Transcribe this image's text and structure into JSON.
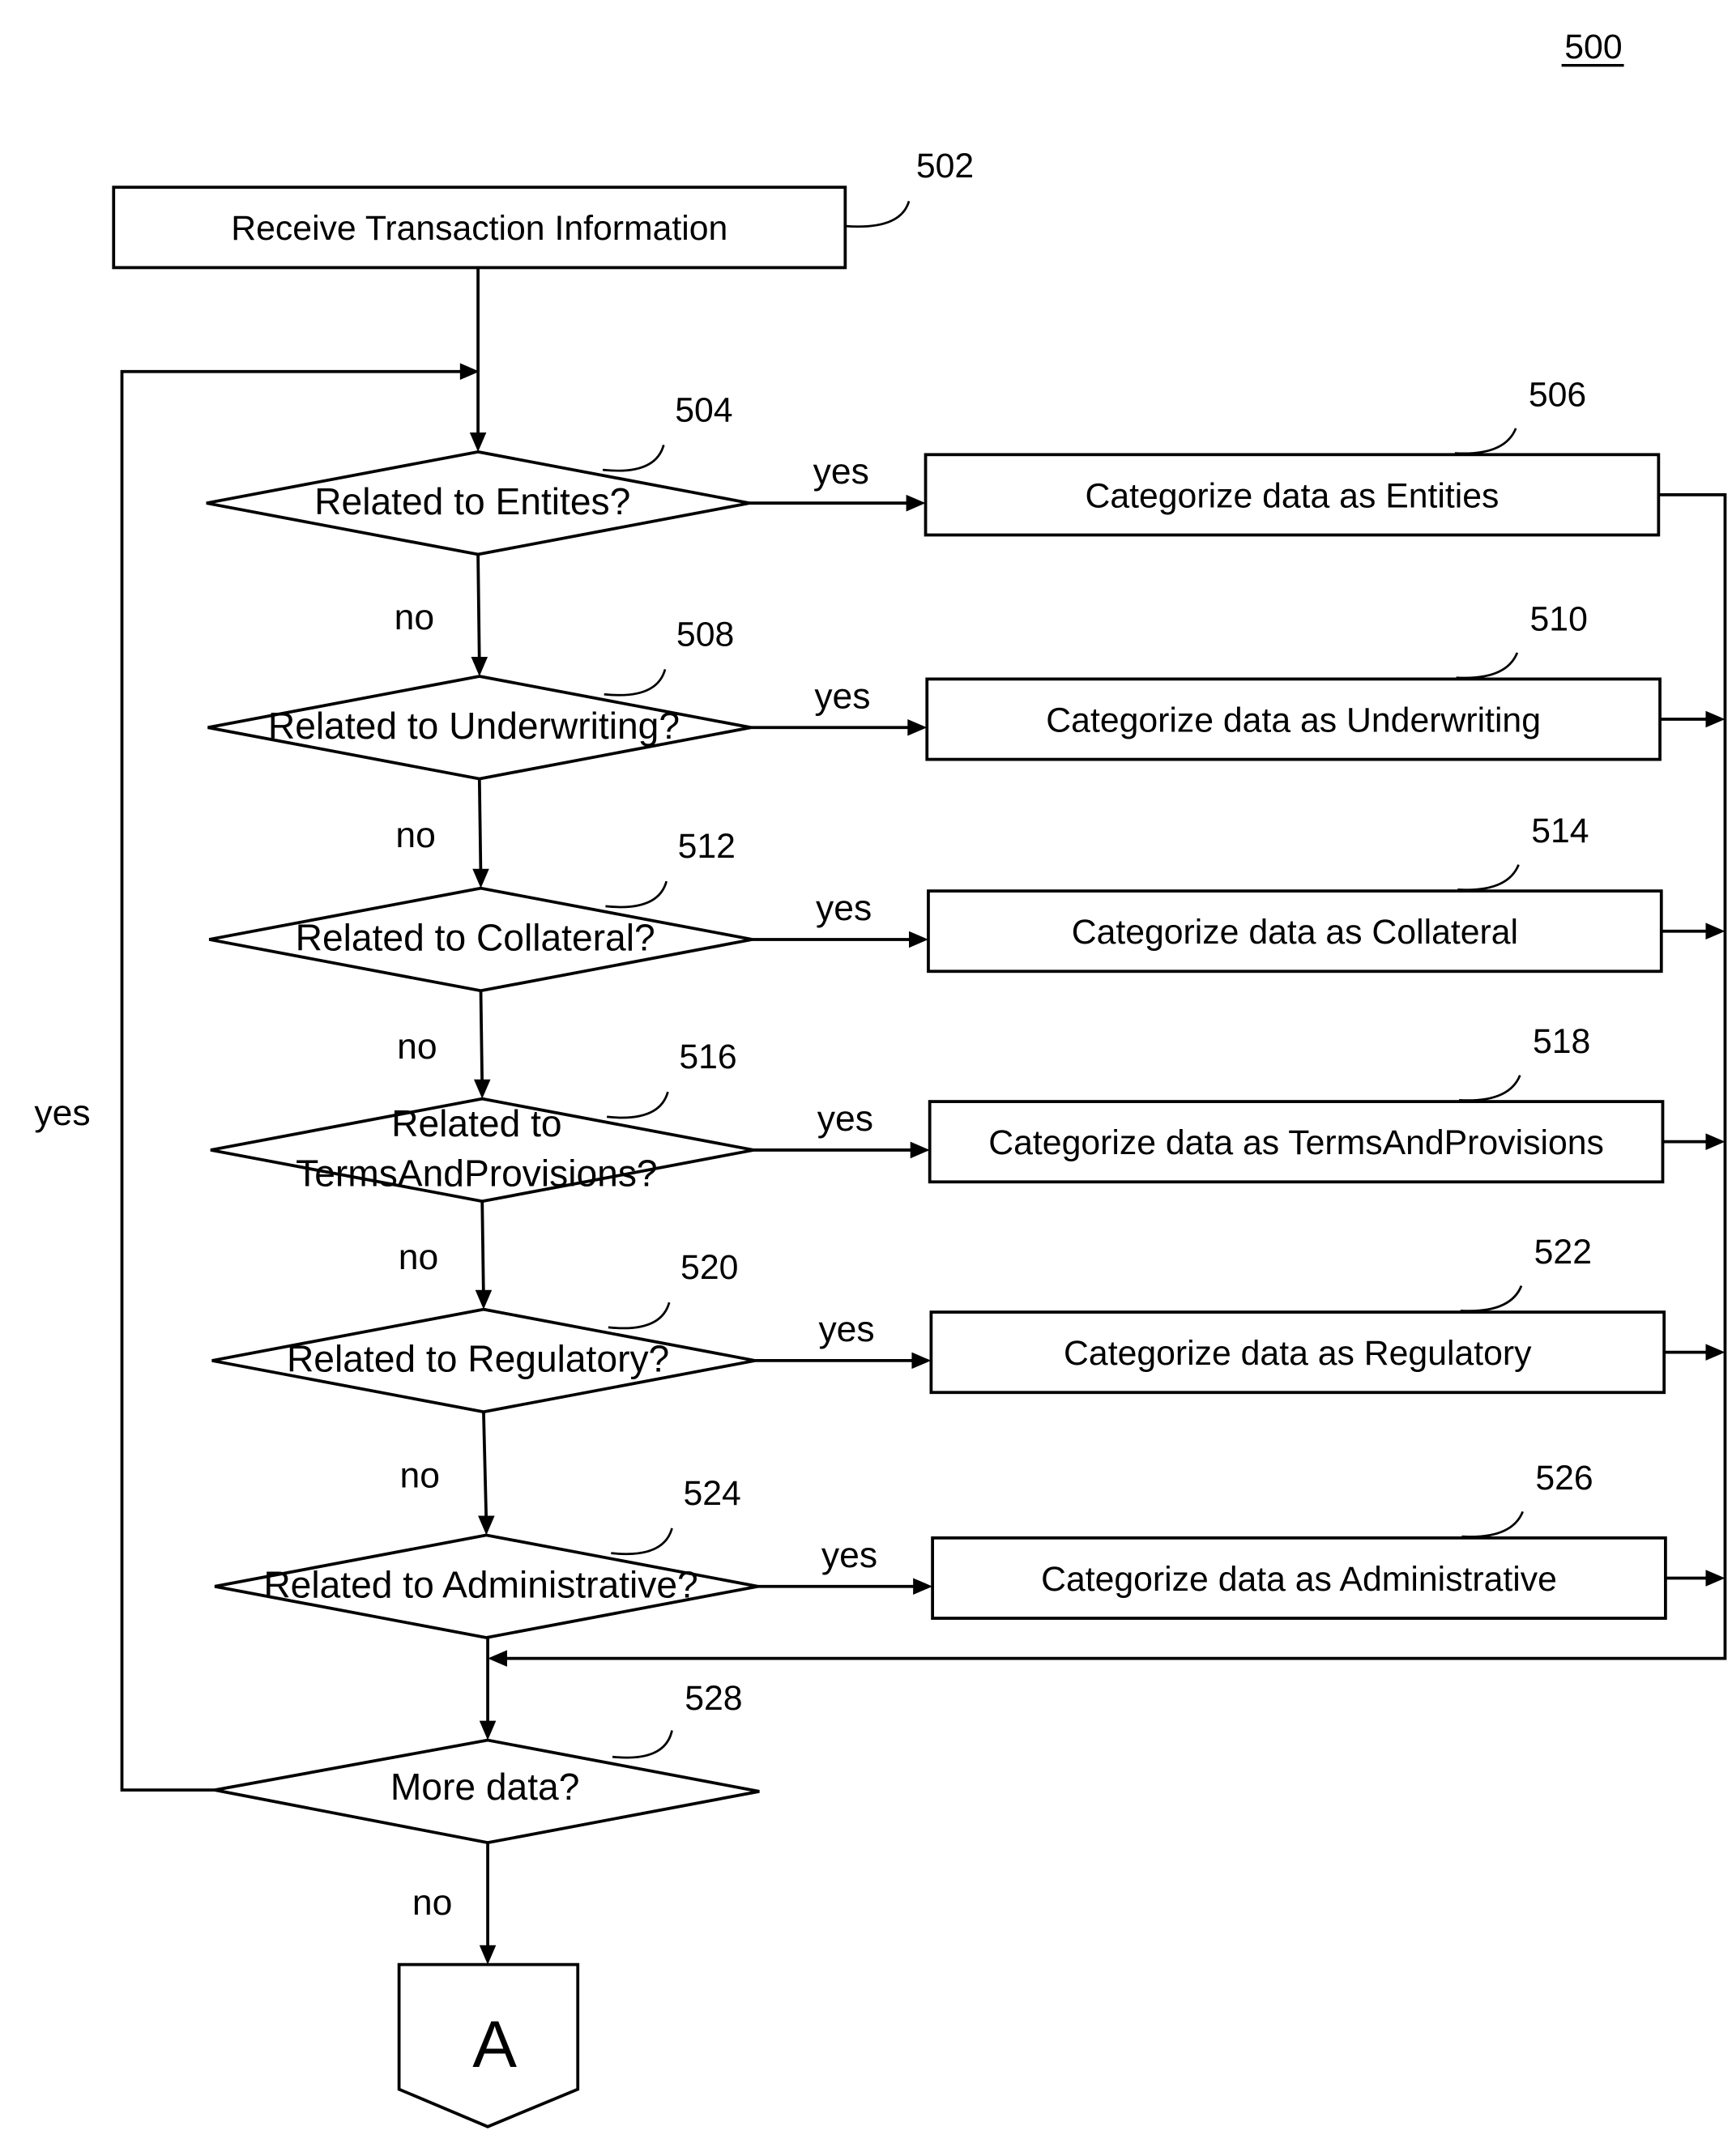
{
  "figure_number": "500",
  "start": {
    "ref": "502",
    "label": "Receive  Transaction Information"
  },
  "decisions": [
    {
      "ref": "504",
      "lines": [
        "Related to Entites?"
      ],
      "yes_label": "yes",
      "no_label": "no"
    },
    {
      "ref": "508",
      "lines": [
        "Related to Underwriting?"
      ],
      "yes_label": "yes",
      "no_label": "no"
    },
    {
      "ref": "512",
      "lines": [
        "Related to Collateral?"
      ],
      "yes_label": "yes",
      "no_label": "no"
    },
    {
      "ref": "516",
      "lines": [
        "Related to",
        "TermsAndProvisions?"
      ],
      "yes_label": "yes",
      "no_label": "no"
    },
    {
      "ref": "520",
      "lines": [
        "Related to Regulatory?"
      ],
      "yes_label": "yes",
      "no_label": "no"
    },
    {
      "ref": "524",
      "lines": [
        "Related to Administrative?"
      ],
      "yes_label": "yes",
      "no_label": ""
    }
  ],
  "actions": [
    {
      "ref": "506",
      "label": "Categorize data as Entities"
    },
    {
      "ref": "510",
      "label": "Categorize data as Underwriting"
    },
    {
      "ref": "514",
      "label": "Categorize data as Collateral"
    },
    {
      "ref": "518",
      "label": "Categorize data as TermsAndProvisions"
    },
    {
      "ref": "522",
      "label": "Categorize data as Regulatory"
    },
    {
      "ref": "526",
      "label": "Categorize data as Administrative"
    }
  ],
  "final_decision": {
    "ref": "528",
    "label": "More data?",
    "yes_label": "yes",
    "no_label": "no"
  },
  "connector": {
    "label": "A"
  }
}
